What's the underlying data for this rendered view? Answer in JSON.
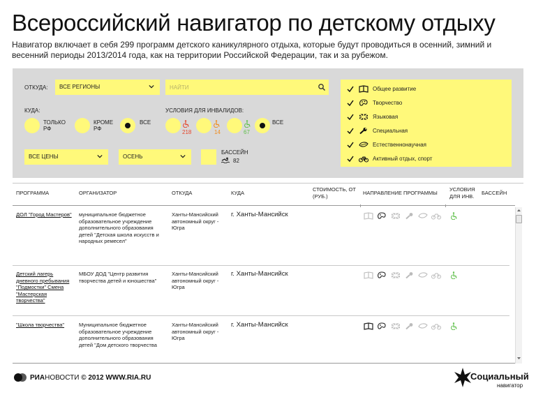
{
  "title": "Всероссийский навигатор по детскому отдыху",
  "subtitle": "Навигатор включает в себя 299 программ детского каникулярного отдыха, которые будут проводиться в осенний, зимний и весенний периоды 2013/2014 года, как на территории Российской Федерации, так и за рубежом.",
  "filters": {
    "from_label": "ОТКУДА:",
    "from_value": "ВСЕ РЕГИОНЫ",
    "search_placeholder": "НАЙТИ",
    "to_label": "КУДА:",
    "to_options": [
      "ТОЛЬКО РФ",
      "КРОМЕ РФ",
      "ВСЕ"
    ],
    "disabled_label": "УСЛОВИЯ ДЛЯ ИНВАЛИДОВ:",
    "disabled_counts": [
      "218",
      "14",
      "67"
    ],
    "disabled_all": "ВСЕ",
    "price_value": "ВСЕ ЦЕНЫ",
    "season_value": "ОСЕНЬ",
    "pool_label": "БАССЕЙН",
    "pool_count": "82"
  },
  "directions": [
    {
      "label": "Общее развитие",
      "icon": "book-icon"
    },
    {
      "label": "Творчество",
      "icon": "palette-icon"
    },
    {
      "label": "Языковая",
      "icon": "flag-icon"
    },
    {
      "label": "Специальная",
      "icon": "wrench-icon"
    },
    {
      "label": "Естественнонаучная",
      "icon": "leaf-icon"
    },
    {
      "label": "Активный отдых, спорт",
      "icon": "bicycle-icon"
    }
  ],
  "table": {
    "headers": {
      "program": "ПРОГРАММА",
      "organizer": "ОРГАНИЗАТОР",
      "from": "ОТКУДА",
      "to": "КУДА",
      "price": "СТОИМОСТЬ, ОТ (РУБ.)",
      "direction": "НАПРАВЛЕНИЕ ПРОГРАММЫ",
      "disabled": "УСЛОВИЯ ДЛЯ ИНВ.",
      "pool": "БАССЕЙН"
    },
    "rows": [
      {
        "program": "ДОЛ \"Город Мастеров\"",
        "organizer": "муниципальное бюджетное образовательное учреждение дополнительного образования детей \"Детская школа искусств и народных ремесел\"",
        "from": "Ханты-Мансийский автономный округ - Югра",
        "to": "г. Ханты-Мансийск"
      },
      {
        "program": "Детский лагерь дневного пребывания \"Подмостки\" Смена \"Мастерская творчества\"",
        "organizer": "МБОУ ДОД \"Центр развития творчества детей и юношества\"",
        "from": "Ханты-Мансийский автономный округ - Югра",
        "to": "г. Ханты-Мансийск"
      },
      {
        "program": "\"Школа творчества\"",
        "organizer": "Муниципальное бюджетное образовательное учреждение дополнительного образования детей \"Дом детского творчества",
        "from": "Ханты-Мансийский автономный округ - Югра",
        "to": "г. Ханты-Мансийск"
      }
    ]
  },
  "footer": {
    "ria_bold": "РИА",
    "ria_light": "НОВОСТИ",
    "copyright": "© 2012 WWW.RIA.RU",
    "brand_title": "Социальный",
    "brand_sub": "навигатор"
  },
  "colors": {
    "accent_yellow": "#fff97a",
    "panel_gray": "#d9d9d9",
    "disabled_red": "#e5462c",
    "disabled_orange": "#f08c1e",
    "disabled_green": "#5fbf4a"
  }
}
